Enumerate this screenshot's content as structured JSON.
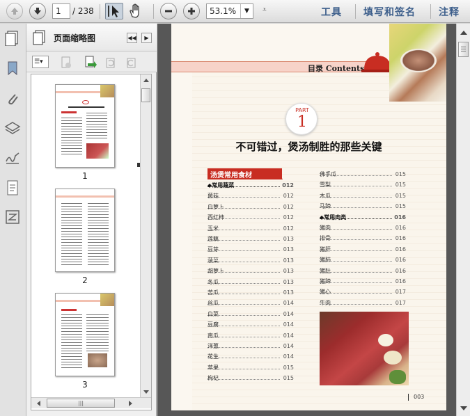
{
  "toolbar": {
    "page_current": "1",
    "page_total": "/ 238",
    "zoom": "53.1%",
    "links": [
      "工具",
      "填写和签名",
      "注释"
    ]
  },
  "sidebar": {
    "title": "页面缩略图",
    "thumbs": [
      {
        "label": "1"
      },
      {
        "label": "2"
      },
      {
        "label": "3"
      }
    ]
  },
  "doc": {
    "header": "目录 Contents",
    "part_word": "PART",
    "part_num": "1",
    "chapter_title": "不可错过，煲汤制胜的那些关键",
    "section_label": "汤煲常用食材",
    "left_rows": [
      {
        "name": "◆常用蔬菜",
        "page": "012",
        "bold": true
      },
      {
        "name": "菌菇",
        "page": "012"
      },
      {
        "name": "白萝卜",
        "page": "012"
      },
      {
        "name": "西红柿",
        "page": "012"
      },
      {
        "name": "玉米",
        "page": "012"
      },
      {
        "name": "莲藕",
        "page": "013"
      },
      {
        "name": "豆芽",
        "page": "013"
      },
      {
        "name": "菠菜",
        "page": "013"
      },
      {
        "name": "胡萝卜",
        "page": "013"
      },
      {
        "name": "冬瓜",
        "page": "013"
      },
      {
        "name": "苦瓜",
        "page": "013"
      },
      {
        "name": "丝瓜",
        "page": "014"
      },
      {
        "name": "白菜",
        "page": "014"
      },
      {
        "name": "豆腐",
        "page": "014"
      },
      {
        "name": "南瓜",
        "page": "014"
      },
      {
        "name": "洋葱",
        "page": "014"
      },
      {
        "name": "花生",
        "page": "014"
      },
      {
        "name": "苹果",
        "page": "015"
      },
      {
        "name": "枸杞",
        "page": "015"
      }
    ],
    "right_rows": [
      {
        "name": "佛手瓜",
        "page": "015"
      },
      {
        "name": "雪梨",
        "page": "015"
      },
      {
        "name": "木瓜",
        "page": "015"
      },
      {
        "name": "马蹄",
        "page": "015"
      },
      {
        "name": "◆常用肉类",
        "page": "016",
        "bold": true
      },
      {
        "name": "猪肉",
        "page": "016"
      },
      {
        "name": "排骨",
        "page": "016"
      },
      {
        "name": "猪肝",
        "page": "016"
      },
      {
        "name": "猪肺",
        "page": "016"
      },
      {
        "name": "猪肚",
        "page": "016"
      },
      {
        "name": "猪蹄",
        "page": "016"
      },
      {
        "name": "猪心",
        "page": "017"
      },
      {
        "name": "牛肉",
        "page": "017"
      }
    ],
    "page_number": "003"
  }
}
